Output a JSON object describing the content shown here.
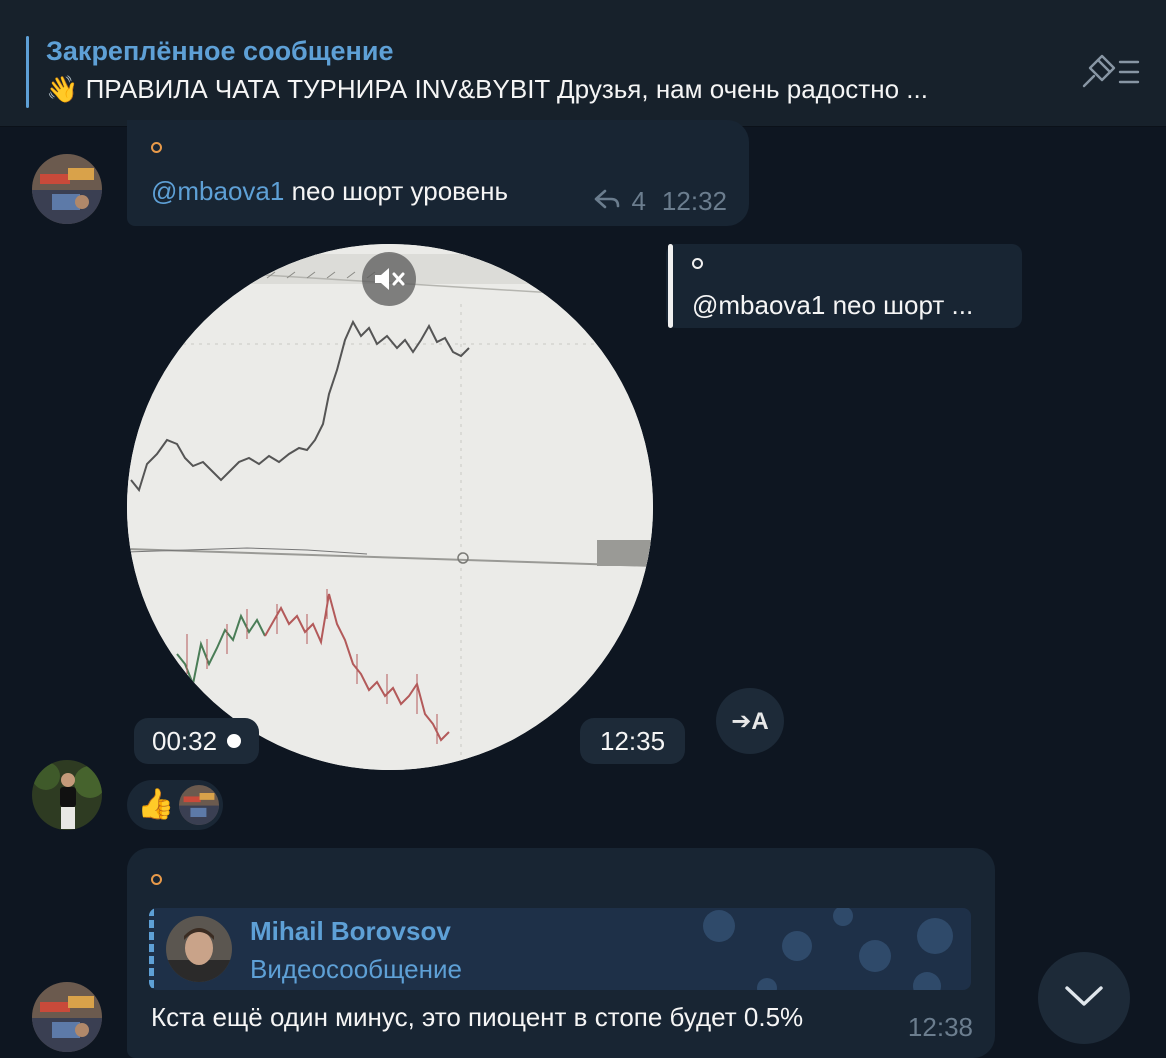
{
  "pinned": {
    "title": "Закреплённое сообщение",
    "text": "👋 ПРАВИЛА ЧАТА ТУРНИРА INV&BYBIT  Друзья, нам очень радостно ..."
  },
  "message1": {
    "mention": "@mbaova1",
    "text": " neo шорт уровень",
    "replies": "4",
    "time": "12:32"
  },
  "video_message": {
    "duration": "00:32",
    "time": "12:35",
    "translate_label": "➔A",
    "reply_preview": "@mbaova1 neo шорт ..."
  },
  "reactions": {
    "emoji": "👍"
  },
  "message2": {
    "quote_author": "Mihail Borovsov",
    "quote_type": "Видеосообщение",
    "text": "Кста ещё один минус, это пиоцент в стопе будет 0.5%",
    "time": "12:38"
  },
  "colors": {
    "background": "#0e1621",
    "bubble": "#182533",
    "accent": "#5ea0d6"
  },
  "icons": [
    "pin-list-icon",
    "reply-arrow-icon",
    "mute-icon",
    "record-dot-icon",
    "translate-icon",
    "chevron-down-icon"
  ]
}
